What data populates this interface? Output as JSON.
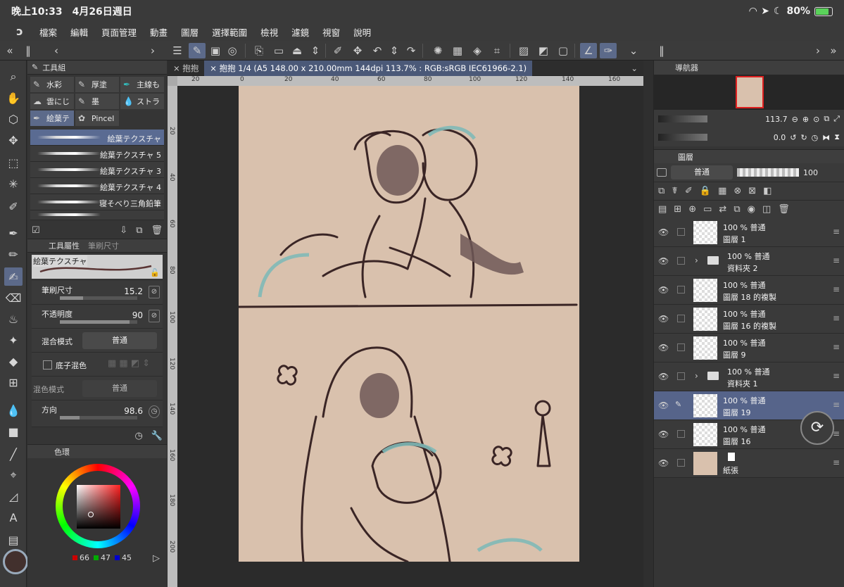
{
  "status": {
    "time": "晚上10:33",
    "date": "4月26日週日",
    "battery": "80%"
  },
  "menu": [
    "檔案",
    "編輯",
    "頁面管理",
    "動畫",
    "圖層",
    "選擇範圍",
    "檢視",
    "濾鏡",
    "視窗",
    "說明"
  ],
  "tool_panel": {
    "title": "工具組",
    "subtools": [
      "水彩",
      "厚塗",
      "主線も",
      "雲にじ",
      "墨",
      "ストラ",
      "絵葉テ",
      "Pincel"
    ],
    "brushes": [
      "絵葉テクスチャ",
      "絵葉テクスチャ 5",
      "絵葉テクスチャ 3",
      "絵葉テクスチャ 4",
      "寝そべり三角鉛筆"
    ]
  },
  "tool_property": {
    "title": "工具屬性",
    "tab2": "筆刷尺寸",
    "preset_name": "絵葉テクスチャ",
    "brush_size_label": "筆刷尺寸",
    "brush_size": "15.2",
    "opacity_label": "不透明度",
    "opacity": "90",
    "blend_label": "混合模式",
    "blend": "普通",
    "underlay_label": "底子混色",
    "color_blend_label": "混色模式",
    "color_blend": "普通",
    "direction_label": "方向",
    "direction": "98.6"
  },
  "color": {
    "title": "色環",
    "r": "66",
    "g": "47",
    "b": "45"
  },
  "document": {
    "tab1": "抱抱",
    "tab2": "抱抱 1/4 (A5 148.00 x 210.00mm 144dpi 113.7% : RGB:sRGB IEC61966-2.1)",
    "ruler_h": [
      "20",
      "0",
      "20",
      "40",
      "60",
      "80",
      "100",
      "120",
      "140",
      "160"
    ],
    "ruler_v": [
      "20",
      "40",
      "60",
      "80",
      "100",
      "120",
      "140",
      "160",
      "180",
      "200"
    ]
  },
  "navigator": {
    "title": "導航器",
    "zoom": "113.7",
    "rotate": "0.0"
  },
  "layers": {
    "title": "圖層",
    "blend": "普通",
    "opacity": "100",
    "items": [
      {
        "pct": "100 %",
        "mode": "普通",
        "name": "圖層 1",
        "type": "layer"
      },
      {
        "pct": "100 %",
        "mode": "普通",
        "name": "資料夾 2",
        "type": "folder"
      },
      {
        "pct": "100 %",
        "mode": "普通",
        "name": "圖層 18 的複製",
        "type": "layer"
      },
      {
        "pct": "100 %",
        "mode": "普通",
        "name": "圖層 16 的複製",
        "type": "layer"
      },
      {
        "pct": "100 %",
        "mode": "普通",
        "name": "圖層 9",
        "type": "layer"
      },
      {
        "pct": "100 %",
        "mode": "普通",
        "name": "資料夾 1",
        "type": "folder"
      },
      {
        "pct": "100 %",
        "mode": "普通",
        "name": "圖層 19",
        "type": "layer"
      },
      {
        "pct": "100 %",
        "mode": "普通",
        "name": "圖層 16",
        "type": "layer"
      },
      {
        "pct": "",
        "mode": "",
        "name": "紙張",
        "type": "paper"
      }
    ]
  }
}
